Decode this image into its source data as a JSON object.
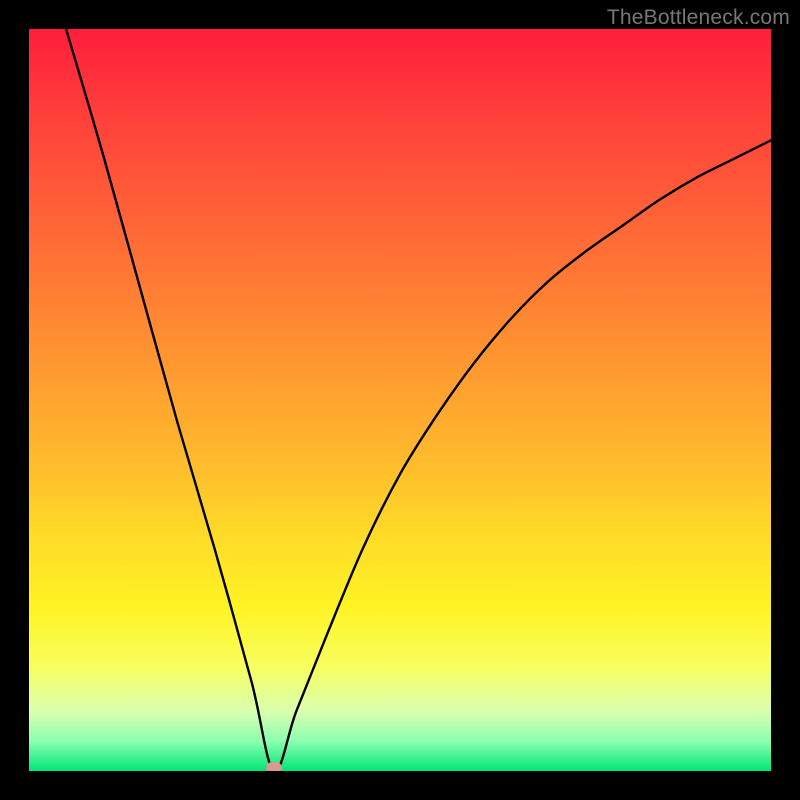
{
  "watermark": "TheBottleneck.com",
  "chart_data": {
    "type": "line",
    "title": "",
    "xlabel": "",
    "ylabel": "",
    "xlim": [
      0,
      100
    ],
    "ylim": [
      0,
      100
    ],
    "grid": false,
    "legend": false,
    "minimum_x": 33,
    "series": [
      {
        "name": "bottleneck-curve",
        "x": [
          5,
          10,
          15,
          20,
          25,
          30,
          33,
          36,
          40,
          45,
          50,
          55,
          60,
          65,
          70,
          75,
          80,
          85,
          90,
          95,
          100
        ],
        "values": [
          100,
          83,
          65,
          47,
          30,
          12,
          0,
          8,
          18,
          30,
          40,
          48,
          55,
          61,
          66,
          70,
          73.5,
          77,
          80,
          82.5,
          85
        ]
      }
    ],
    "marker": {
      "x": 33,
      "y": 0
    },
    "background_gradient": {
      "stops": [
        {
          "pos": 0.0,
          "color": "#ff1e3c"
        },
        {
          "pos": 0.1,
          "color": "#ff3b3b"
        },
        {
          "pos": 0.22,
          "color": "#ff5a38"
        },
        {
          "pos": 0.34,
          "color": "#ff7a34"
        },
        {
          "pos": 0.46,
          "color": "#ff9a30"
        },
        {
          "pos": 0.58,
          "color": "#ffba2c"
        },
        {
          "pos": 0.68,
          "color": "#ffda28"
        },
        {
          "pos": 0.78,
          "color": "#fff324"
        },
        {
          "pos": 0.86,
          "color": "#f7ff60"
        },
        {
          "pos": 0.92,
          "color": "#d9ffb0"
        },
        {
          "pos": 0.96,
          "color": "#8cffb0"
        },
        {
          "pos": 1.0,
          "color": "#00e676"
        }
      ]
    }
  }
}
